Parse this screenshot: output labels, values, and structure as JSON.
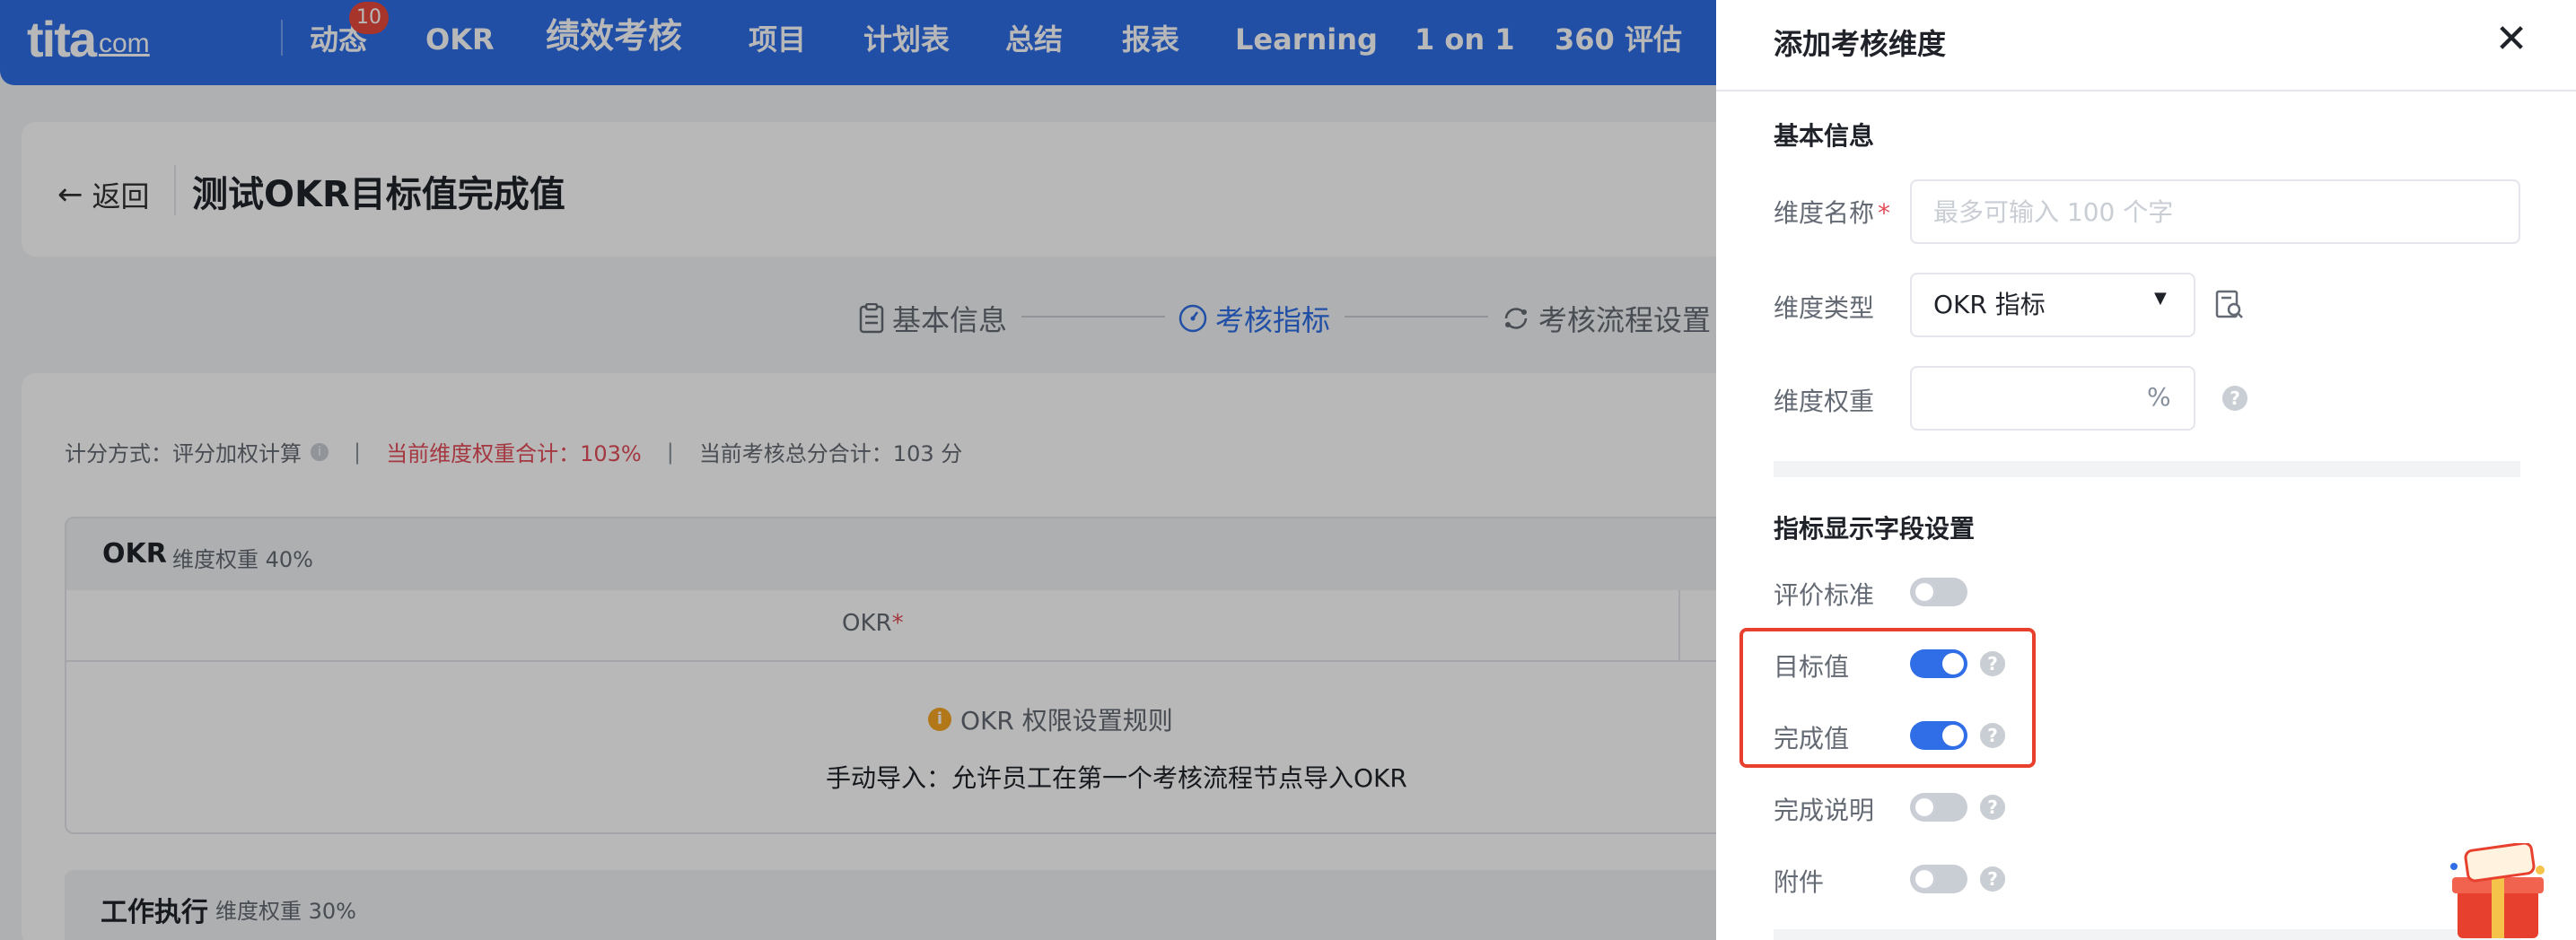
{
  "nav": {
    "logo_main": "tita",
    "logo_suffix": "com",
    "badge": "10",
    "items": [
      "动态",
      "OKR",
      "绩效考核",
      "项目",
      "计划表",
      "总结",
      "报表",
      "Learning",
      "1 on 1",
      "360 评估"
    ]
  },
  "header": {
    "back_label": "返回",
    "title": "测试OKR目标值完成值"
  },
  "steps": [
    "基本信息",
    "考核指标",
    "考核流程设置"
  ],
  "calc": {
    "method": "计分方式：评分加权计算",
    "weight_total": "当前维度权重合计：103%",
    "score_total": "当前考核总分合计：103 分"
  },
  "okr_section": {
    "title": "OKR",
    "weight": "维度权重 40%",
    "column": "OKR",
    "required_mark": "*",
    "rule_title": "OKR 权限设置规则",
    "rule_text": "手动导入：允许员工在第一个考核流程节点导入OKR"
  },
  "work_section": {
    "title": "工作执行",
    "weight": "维度权重 30%"
  },
  "drawer": {
    "title": "添加考核维度",
    "basic_section": "基本信息",
    "name_label": "维度名称",
    "required_mark": "*",
    "name_placeholder": "最多可输入 100 个字",
    "type_label": "维度类型",
    "type_value": "OKR 指标",
    "weight_label": "维度权重",
    "weight_unit": "%",
    "display_section": "指标显示字段设置",
    "fields": [
      {
        "label": "评价标准",
        "on": false,
        "help": false
      },
      {
        "label": "目标值",
        "on": true,
        "help": true
      },
      {
        "label": "完成值",
        "on": true,
        "help": true
      },
      {
        "label": "完成说明",
        "on": false,
        "help": true
      },
      {
        "label": "附件",
        "on": false,
        "help": true
      }
    ]
  },
  "colors": {
    "primary": "#2f6ee6",
    "highlight": "#e8402f",
    "danger": "#e34d59"
  }
}
